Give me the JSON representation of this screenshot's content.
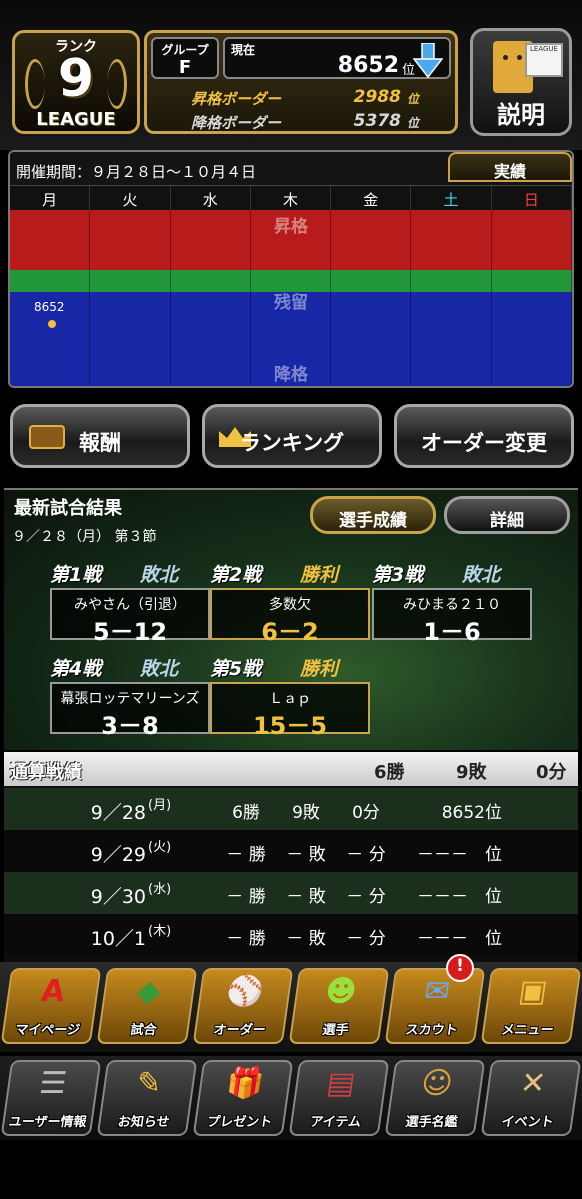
{
  "rank": {
    "label": "ランク",
    "number": "9",
    "league": "LEAGUE"
  },
  "group": {
    "label": "グループ",
    "value": "F"
  },
  "current": {
    "label": "現在",
    "value": "8652",
    "unit": "位"
  },
  "promotion": {
    "label": "昇格ボーダー",
    "value": "2988",
    "unit": "位"
  },
  "demotion": {
    "label": "降格ボーダー",
    "value": "5378",
    "unit": "位"
  },
  "explain": {
    "label": "説明",
    "board_text": "LEAGUE"
  },
  "period": {
    "title": "開催期間：９月２８日〜１０月４日",
    "tab": "実績",
    "days": [
      "月",
      "火",
      "水",
      "木",
      "金",
      "土",
      "日"
    ],
    "zone_up": "昇格",
    "zone_mid": "残留",
    "zone_down": "降格",
    "point_label": "8652"
  },
  "buttons": {
    "reward": "報酬",
    "ranking": "ランキング",
    "order": "オーダー変更"
  },
  "results": {
    "title": "最新試合結果",
    "date": "９／２８（月） 第３節",
    "player_button": "選手成績",
    "detail_button": "詳細",
    "games": [
      {
        "num": "第1戦",
        "result": "敗北",
        "opponent": "みやさん（引退）",
        "score": "5－12",
        "win": false
      },
      {
        "num": "第2戦",
        "result": "勝利",
        "opponent": "多数欠",
        "score": "6－2",
        "win": true
      },
      {
        "num": "第3戦",
        "result": "敗北",
        "opponent": "みひまる２１０",
        "score": "1－6",
        "win": false
      },
      {
        "num": "第4戦",
        "result": "敗北",
        "opponent": "幕張ロッテマリーンズ",
        "score": "3－8",
        "win": false
      },
      {
        "num": "第5戦",
        "result": "勝利",
        "opponent": "Ｌａｐ",
        "score": "15－5",
        "win": true
      }
    ]
  },
  "totals": {
    "title": "通算戦績",
    "wins": "6勝",
    "losses": "9敗",
    "draws": "0分",
    "rows": [
      {
        "date": "9／28",
        "dow": "(月)",
        "w": "6勝",
        "l": "9敗",
        "d": "0分",
        "rank": "8652位"
      },
      {
        "date": "9／29",
        "dow": "(火)",
        "w": "－ 勝",
        "l": "－ 敗",
        "d": "－ 分",
        "rank": "－－－　位"
      },
      {
        "date": "9／30",
        "dow": "(水)",
        "w": "－ 勝",
        "l": "－ 敗",
        "d": "－ 分",
        "rank": "－－－　位"
      },
      {
        "date": "10／1",
        "dow": "(木)",
        "w": "－ 勝",
        "l": "－ 敗",
        "d": "－ 分",
        "rank": "－－－　位"
      }
    ]
  },
  "nav_main": [
    {
      "label": "マイページ",
      "glyph": "A"
    },
    {
      "label": "試合",
      "glyph": "◆"
    },
    {
      "label": "オーダー",
      "glyph": "⚾"
    },
    {
      "label": "選手",
      "glyph": "☻"
    },
    {
      "label": "スカウト",
      "glyph": "✉"
    },
    {
      "label": "メニュー",
      "glyph": "▣"
    }
  ],
  "nav_sub": [
    {
      "label": "ユーザー情報",
      "glyph": "☰"
    },
    {
      "label": "お知らせ",
      "glyph": "✎"
    },
    {
      "label": "プレゼント",
      "glyph": "🎁"
    },
    {
      "label": "アイテム",
      "glyph": "▤"
    },
    {
      "label": "選手名鑑",
      "glyph": "☺"
    },
    {
      "label": "イベント",
      "glyph": "✕"
    }
  ],
  "scout_badge": "!",
  "colors": {
    "gold": "#c9a24a",
    "red_zone": "#b81b1b",
    "green_zone": "#22963a",
    "blue_zone": "#1727a6",
    "saturday": "#49d4f0",
    "sunday": "#ff4040"
  }
}
